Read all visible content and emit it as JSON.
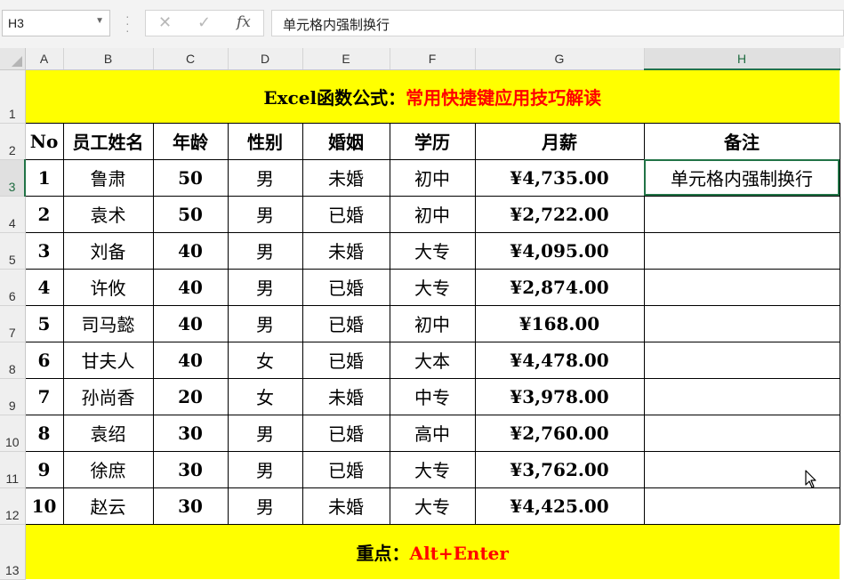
{
  "name_box": {
    "value": "H3"
  },
  "formula_bar": {
    "cancel_glyph": "✕",
    "enter_glyph": "✓",
    "fx_label": "fx",
    "content": "单元格内强制换行"
  },
  "columns": [
    "A",
    "B",
    "C",
    "D",
    "E",
    "F",
    "G",
    "H"
  ],
  "rows": [
    "1",
    "2",
    "3",
    "4",
    "5",
    "6",
    "7",
    "8",
    "9",
    "10",
    "11",
    "12",
    "13"
  ],
  "banner": {
    "black": "Excel函数公式：",
    "red": "常用快捷键应用技巧解读"
  },
  "headers": [
    "No",
    "员工姓名",
    "年龄",
    "性别",
    "婚姻",
    "学历",
    "月薪",
    "备注"
  ],
  "data_rows": [
    [
      "1",
      "鲁肃",
      "50",
      "男",
      "未婚",
      "初中",
      "¥4,735.00",
      "单元格内强制换行"
    ],
    [
      "2",
      "袁术",
      "50",
      "男",
      "已婚",
      "初中",
      "¥2,722.00",
      ""
    ],
    [
      "3",
      "刘备",
      "40",
      "男",
      "未婚",
      "大专",
      "¥4,095.00",
      ""
    ],
    [
      "4",
      "许攸",
      "40",
      "男",
      "已婚",
      "大专",
      "¥2,874.00",
      ""
    ],
    [
      "5",
      "司马懿",
      "40",
      "男",
      "已婚",
      "初中",
      "¥168.00",
      ""
    ],
    [
      "6",
      "甘夫人",
      "40",
      "女",
      "已婚",
      "大本",
      "¥4,478.00",
      ""
    ],
    [
      "7",
      "孙尚香",
      "20",
      "女",
      "未婚",
      "中专",
      "¥3,978.00",
      ""
    ],
    [
      "8",
      "袁绍",
      "30",
      "男",
      "已婚",
      "高中",
      "¥2,760.00",
      ""
    ],
    [
      "9",
      "徐庶",
      "30",
      "男",
      "已婚",
      "大专",
      "¥3,762.00",
      ""
    ],
    [
      "10",
      "赵云",
      "30",
      "男",
      "未婚",
      "大专",
      "¥4,425.00",
      ""
    ]
  ],
  "footer": {
    "black": "重点：",
    "red": "Alt+Enter"
  },
  "colors": {
    "banner_fill": "#ffff00",
    "accent_red": "#ff0000",
    "selection_green": "#217346"
  }
}
